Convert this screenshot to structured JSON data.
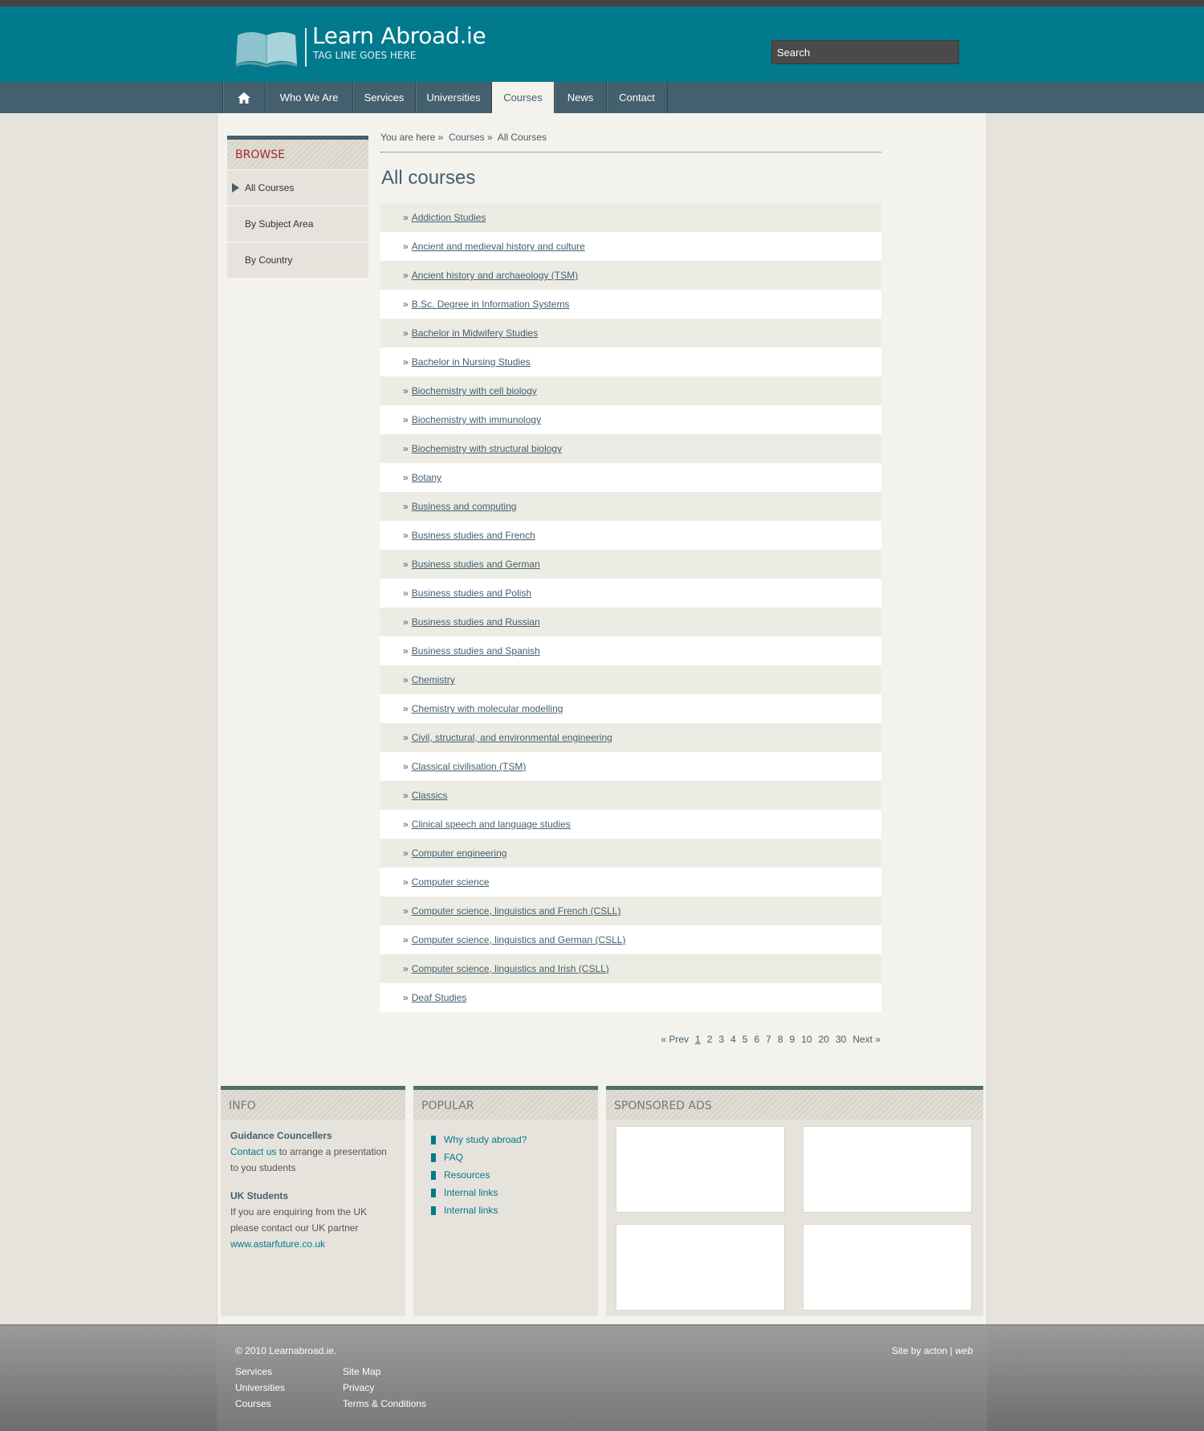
{
  "site": {
    "logo_title": "Learn Abroad.ie",
    "tagline": "TAG LINE GOES HERE"
  },
  "search": {
    "placeholder": "Search"
  },
  "nav": {
    "items": [
      {
        "label": "Who We Are"
      },
      {
        "label": "Services"
      },
      {
        "label": "Universities"
      },
      {
        "label": "Courses"
      },
      {
        "label": "News"
      },
      {
        "label": "Contact"
      }
    ],
    "active": "Courses"
  },
  "browse": {
    "title": "BROWSE",
    "items": [
      {
        "label": "All Courses"
      },
      {
        "label": "By Subject Area"
      },
      {
        "label": "By Country"
      }
    ]
  },
  "breadcrumb": {
    "prefix": "You are here »",
    "level1": "Courses",
    "separator": "»",
    "current": "All Courses"
  },
  "page_title": "All courses",
  "courses": [
    "Addiction Studies",
    "Ancient and medieval history and culture",
    "Ancient history and archaeology (TSM)",
    "B.Sc. Degree in Information Systems",
    "Bachelor in Midwifery Studies",
    "Bachelor in Nursing Studies",
    "Biochemistry with cell biology",
    "Biochemistry with immunology",
    "Biochemistry with structural biology",
    "Botany",
    "Business and computing",
    "Business studies and French",
    "Business studies and German",
    "Business studies and Polish",
    "Business studies and Russian",
    "Business studies and Spanish",
    "Chemistry",
    "Chemistry with molecular modelling",
    "Civil, structural, and environmental engineering",
    "Classical civilisation (TSM)",
    "Classics",
    "Clinical speech and language studies",
    "Computer engineering",
    "Computer science",
    "Computer science, linguistics and French (CSLL)",
    "Computer science, linguistics and German (CSLL)",
    "Computer science, linguistics and Irish (CSLL)",
    "Deaf Studies"
  ],
  "pagination": {
    "prev": "« Prev",
    "pages": [
      "1",
      "2",
      "3",
      "4",
      "5",
      "6",
      "7",
      "8",
      "9",
      "10",
      "20",
      "30"
    ],
    "current": "1",
    "next": "Next »"
  },
  "info": {
    "title": "INFO",
    "guidance_heading": "Guidance Councellers",
    "guidance_link": "Contact us",
    "guidance_text": "to arrange a presentation to you students",
    "uk_heading": "UK Students",
    "uk_text": "If you are enquiring from the UK please contact our UK partner",
    "uk_link": "www.astarfuture.co.uk"
  },
  "popular": {
    "title": "POPULAR",
    "items": [
      "Why study abroad?",
      "FAQ",
      "Resources",
      "Internal links",
      "Internal links"
    ]
  },
  "ads": {
    "title": "SPONSORED ADS"
  },
  "footer": {
    "copyright": "© 2010 Learnabroad.ie.",
    "credit_prefix": "Site by acton |",
    "credit_suffix": "web",
    "col1": [
      "Services",
      "Universities",
      "Courses"
    ],
    "col2": [
      "Site Map",
      "Privacy",
      "Terms & Conditions"
    ]
  },
  "colors": {
    "header": "#007a8c",
    "nav": "#445f6e",
    "browse_title": "#a32b2b",
    "link": "#445f6e"
  }
}
